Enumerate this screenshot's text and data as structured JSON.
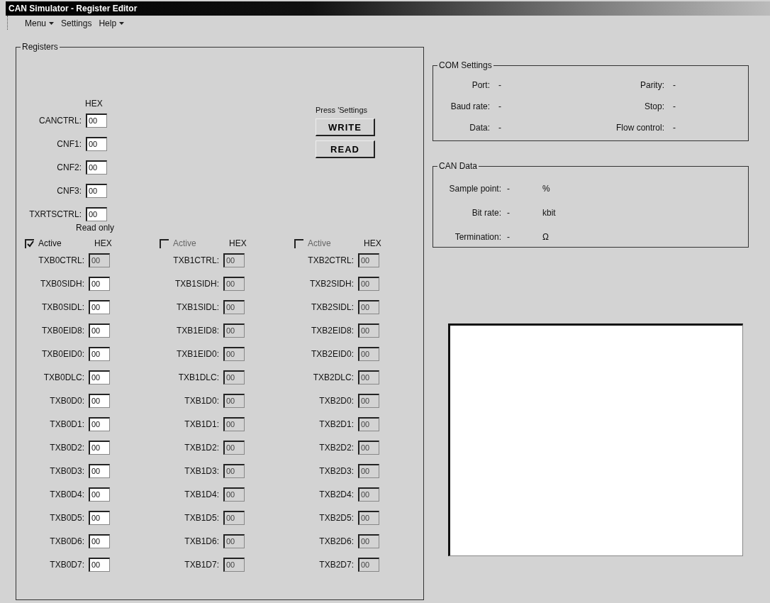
{
  "window": {
    "title": "CAN Simulator - Register Editor"
  },
  "menu": [
    {
      "label": "Menu",
      "dropdown": true
    },
    {
      "label": "Settings",
      "dropdown": false
    },
    {
      "label": "Help",
      "dropdown": true
    }
  ],
  "registers": {
    "title": "Registers",
    "hex_header": "HEX",
    "config": [
      {
        "label": "CANCTRL:",
        "value": "00"
      },
      {
        "label": "CNF1:",
        "value": "00"
      },
      {
        "label": "CNF2:",
        "value": "00"
      },
      {
        "label": "CNF3:",
        "value": "00"
      },
      {
        "label": "TXRTSCTRL:",
        "value": "00"
      }
    ],
    "press_note": "Press 'Settings",
    "buttons": [
      {
        "label": "WRITE"
      },
      {
        "label": "READ"
      }
    ],
    "read_only_note": "Read only",
    "buffers": [
      {
        "active_label": "Active",
        "checked": true,
        "hex_header": "HEX",
        "registers": [
          {
            "label": "TXB0CTRL:",
            "value": "00",
            "disabled": true
          },
          {
            "label": "TXB0SIDH:",
            "value": "00",
            "disabled": false
          },
          {
            "label": "TXB0SIDL:",
            "value": "00",
            "disabled": false
          },
          {
            "label": "TXB0EID8:",
            "value": "00",
            "disabled": false
          },
          {
            "label": "TXB0EID0:",
            "value": "00",
            "disabled": false
          },
          {
            "label": "TXB0DLC:",
            "value": "00",
            "disabled": false
          },
          {
            "label": "TXB0D0:",
            "value": "00",
            "disabled": false
          },
          {
            "label": "TXB0D1:",
            "value": "00",
            "disabled": false
          },
          {
            "label": "TXB0D2:",
            "value": "00",
            "disabled": false
          },
          {
            "label": "TXB0D3:",
            "value": "00",
            "disabled": false
          },
          {
            "label": "TXB0D4:",
            "value": "00",
            "disabled": false
          },
          {
            "label": "TXB0D5:",
            "value": "00",
            "disabled": false
          },
          {
            "label": "TXB0D6:",
            "value": "00",
            "disabled": false
          },
          {
            "label": "TXB0D7:",
            "value": "00",
            "disabled": false
          }
        ]
      },
      {
        "active_label": "Active",
        "checked": false,
        "hex_header": "HEX",
        "registers": [
          {
            "label": "TXB1CTRL:",
            "value": "00",
            "disabled": true
          },
          {
            "label": "TXB1SIDH:",
            "value": "00",
            "disabled": true
          },
          {
            "label": "TXB1SIDL:",
            "value": "00",
            "disabled": true
          },
          {
            "label": "TXB1EID8:",
            "value": "00",
            "disabled": true
          },
          {
            "label": "TXB1EID0:",
            "value": "00",
            "disabled": true
          },
          {
            "label": "TXB1DLC:",
            "value": "00",
            "disabled": true
          },
          {
            "label": "TXB1D0:",
            "value": "00",
            "disabled": true
          },
          {
            "label": "TXB1D1:",
            "value": "00",
            "disabled": true
          },
          {
            "label": "TXB1D2:",
            "value": "00",
            "disabled": true
          },
          {
            "label": "TXB1D3:",
            "value": "00",
            "disabled": true
          },
          {
            "label": "TXB1D4:",
            "value": "00",
            "disabled": true
          },
          {
            "label": "TXB1D5:",
            "value": "00",
            "disabled": true
          },
          {
            "label": "TXB1D6:",
            "value": "00",
            "disabled": true
          },
          {
            "label": "TXB1D7:",
            "value": "00",
            "disabled": true
          }
        ]
      },
      {
        "active_label": "Active",
        "checked": false,
        "hex_header": "HEX",
        "registers": [
          {
            "label": "TXB2CTRL:",
            "value": "00",
            "disabled": true
          },
          {
            "label": "TXB2SIDH:",
            "value": "00",
            "disabled": true
          },
          {
            "label": "TXB2SIDL:",
            "value": "00",
            "disabled": true
          },
          {
            "label": "TXB2EID8:",
            "value": "00",
            "disabled": true
          },
          {
            "label": "TXB2EID0:",
            "value": "00",
            "disabled": true
          },
          {
            "label": "TXB2DLC:",
            "value": "00",
            "disabled": true
          },
          {
            "label": "TXB2D0:",
            "value": "00",
            "disabled": true
          },
          {
            "label": "TXB2D1:",
            "value": "00",
            "disabled": true
          },
          {
            "label": "TXB2D2:",
            "value": "00",
            "disabled": true
          },
          {
            "label": "TXB2D3:",
            "value": "00",
            "disabled": true
          },
          {
            "label": "TXB2D4:",
            "value": "00",
            "disabled": true
          },
          {
            "label": "TXB2D5:",
            "value": "00",
            "disabled": true
          },
          {
            "label": "TXB2D6:",
            "value": "00",
            "disabled": true
          },
          {
            "label": "TXB2D7:",
            "value": "00",
            "disabled": true
          }
        ]
      }
    ]
  },
  "com_settings": {
    "title": "COM Settings",
    "fields": [
      {
        "label": "Port:",
        "value": "-"
      },
      {
        "label": "Parity:",
        "value": "-"
      },
      {
        "label": "Baud rate:",
        "value": "-"
      },
      {
        "label": "Stop:",
        "value": "-"
      },
      {
        "label": "Data:",
        "value": "-"
      },
      {
        "label": "Flow control:",
        "value": "-"
      }
    ]
  },
  "can_data": {
    "title": "CAN Data",
    "fields": [
      {
        "label": "Sample point:",
        "reading": "-",
        "unit": "%"
      },
      {
        "label": "Bit rate:",
        "reading": "-",
        "unit": "kbit"
      },
      {
        "label": "Termination:",
        "reading": "-",
        "unit": "Ω"
      }
    ]
  }
}
